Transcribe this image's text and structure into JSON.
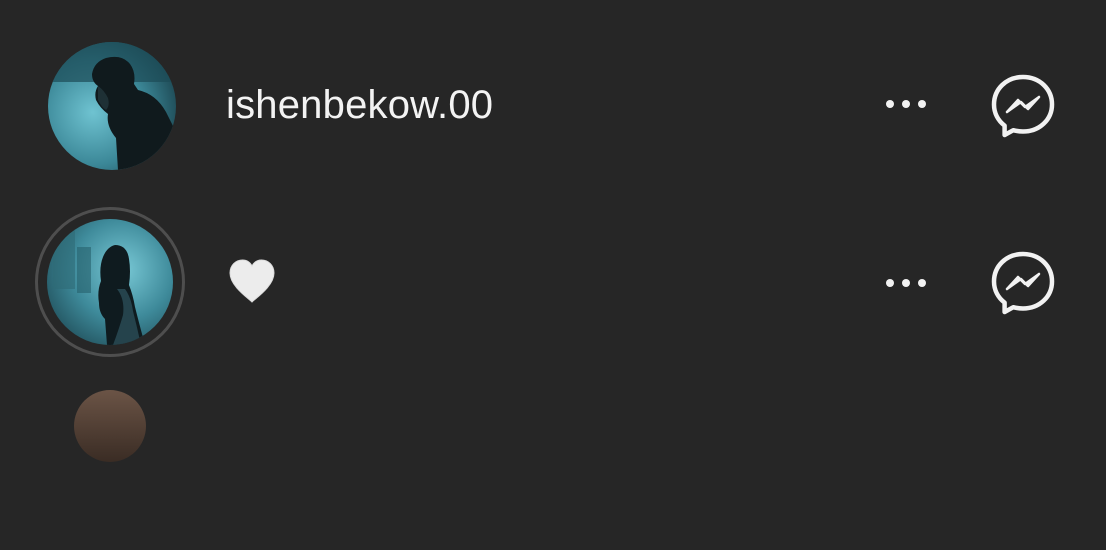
{
  "accounts": [
    {
      "username": "ishenbekow.00",
      "avatar": "man-in-dark-coat-blue-tint-photo",
      "has_story": false,
      "more_icon": "more-horizontal-icon",
      "message_icon": "messenger-icon"
    },
    {
      "username": "🤍",
      "avatar": "woman-profile-blue-tint-photo",
      "has_story": true,
      "more_icon": "more-horizontal-icon",
      "message_icon": "messenger-icon"
    },
    {
      "username": "",
      "avatar": "partial-avatar-photo",
      "has_story": false
    }
  ],
  "colors": {
    "background": "#262626",
    "text": "#f3f3f3",
    "story_ring": "#4e4e4e"
  }
}
